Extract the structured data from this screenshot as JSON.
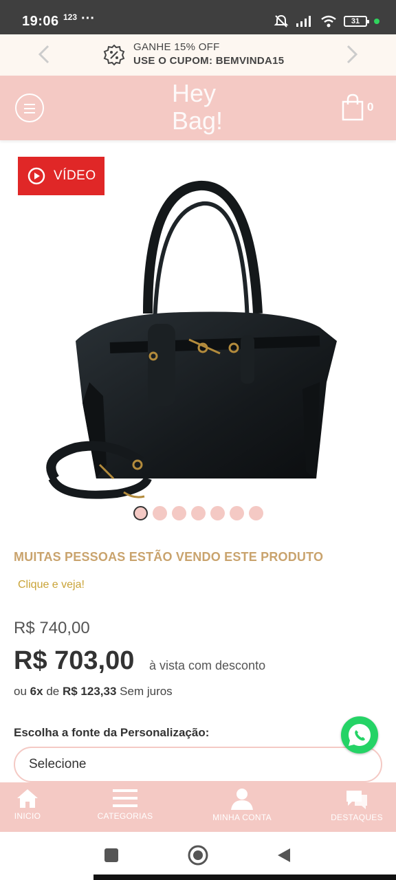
{
  "status_bar": {
    "time": "19:06",
    "extra": "123",
    "dots": "···",
    "battery": "31"
  },
  "promo": {
    "line1": "GANHE 15% OFF",
    "line2": "USE O CUPOM: BEMVINDA15"
  },
  "header": {
    "logo_line1": "Hey",
    "logo_line2": "Bag!",
    "cart_count": "0"
  },
  "product": {
    "video_label": "VÍDEO",
    "gallery_count": 7,
    "gallery_active": 1,
    "viewing_text": "MUITAS PESSOAS ESTÃO VENDO ESTE PRODUTO",
    "click_text": "Clique e veja!",
    "old_price": "R$ 740,00",
    "price": "R$ 703,00",
    "price_note": "à vista com desconto",
    "installments_prefix": "ou",
    "installments_count": "6x",
    "installments_mid": "de",
    "installments_value": "R$ 123,33",
    "installments_suffix": "Sem juros",
    "font_label": "Escolha a fonte da Personalização:",
    "select_value": "Selecione"
  },
  "bottom_nav": [
    {
      "label": "INICIO",
      "icon": "home-icon"
    },
    {
      "label": "CATEGORIAS",
      "icon": "list-icon"
    },
    {
      "label": "MINHA CONTA",
      "icon": "user-icon"
    },
    {
      "label": "DESTAQUES",
      "icon": "chat-icon"
    }
  ],
  "colors": {
    "brand_pink": "#f4c9c4",
    "accent_gold": "#c9a36d",
    "video_red": "#e02727",
    "whatsapp_green": "#25d366"
  }
}
